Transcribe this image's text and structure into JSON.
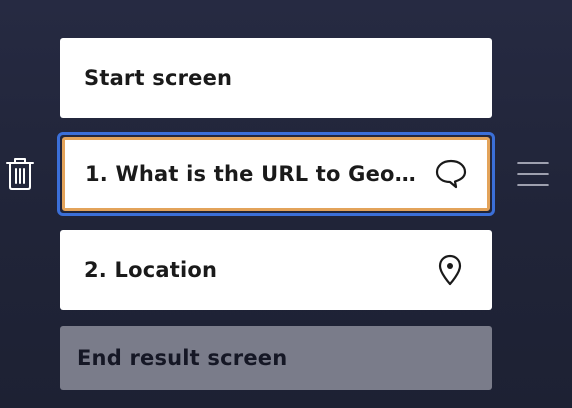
{
  "cards": {
    "start": {
      "label": "Start screen"
    },
    "question": {
      "label": "1. What is the URL to GeoG...",
      "icon": "speech-bubble-icon"
    },
    "location": {
      "label": "2. Location",
      "icon": "location-pin-icon"
    },
    "end": {
      "label": "End result screen"
    }
  },
  "side_controls": {
    "delete_icon": "trash-icon",
    "reorder_icon": "drag-handle-icon"
  },
  "colors": {
    "background": "#232740",
    "selected_outline": "#3b6fd8",
    "selected_border": "#e3a35a",
    "end_card": "#7a7c8a"
  }
}
